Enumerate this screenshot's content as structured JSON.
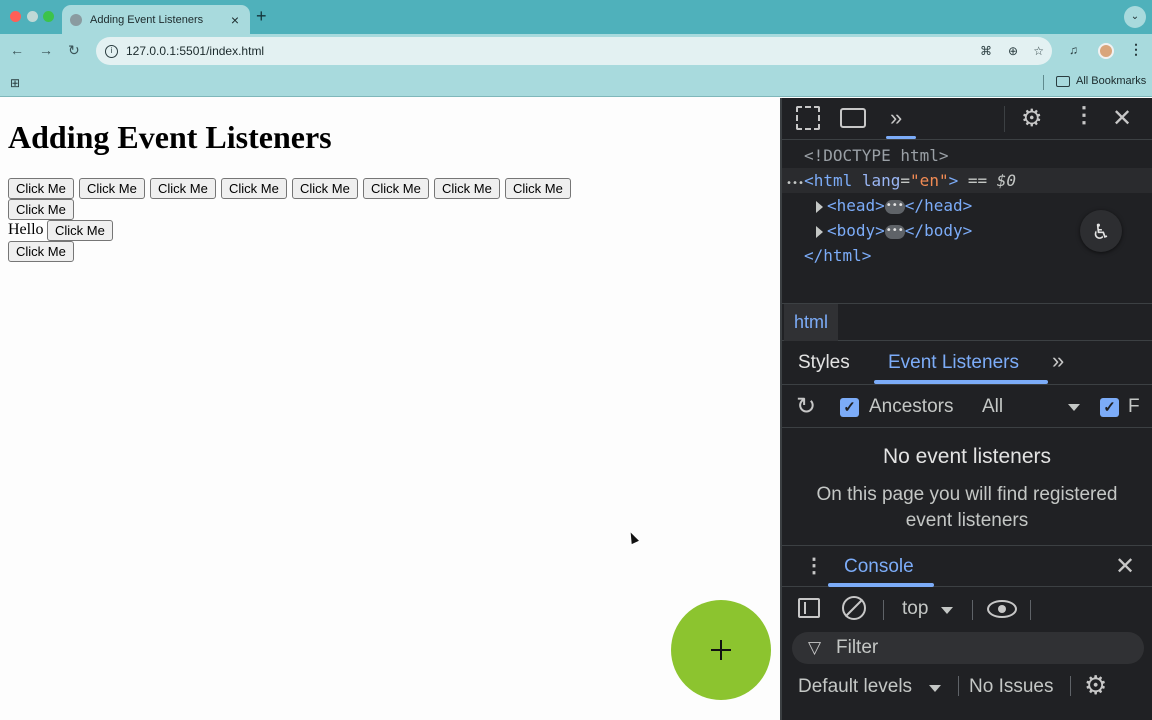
{
  "browser": {
    "tab_title": "Adding Event Listeners",
    "tab_close": "×",
    "new_tab": "+",
    "tab_search": "⌄",
    "url": "127.0.0.1:5501/index.html",
    "site_info": "i",
    "bookmarks_label": "All Bookmarks"
  },
  "page": {
    "heading": "Adding Event Listeners",
    "button_label": "Click Me",
    "hello_text": "Hello"
  },
  "devtools": {
    "elements": {
      "doctype": "<!DOCTYPE html>",
      "html_open": "<html",
      "lang_attr": "lang",
      "lang_val": "\"en\"",
      "html_close_bracket": ">",
      "selected_marker": "== $0",
      "head_open": "<head>",
      "head_close": "</head>",
      "body_open": "<body>",
      "body_close": "</body>",
      "html_close": "</html>",
      "ellipsis": "•••"
    },
    "breadcrumb": "html",
    "tabs": {
      "styles": "Styles",
      "event_listeners": "Event Listeners"
    },
    "listeners_bar": {
      "ancestors": "Ancestors",
      "filter_select": "All",
      "framework": "F"
    },
    "empty": {
      "title": "No event listeners",
      "body": "On this page you will find registered event listeners"
    },
    "drawer": {
      "console_tab": "Console"
    },
    "console": {
      "context": "top",
      "filter_placeholder": "Filter",
      "levels": "Default levels",
      "issues": "No Issues"
    }
  },
  "colors": {
    "fab": "#8cc42f",
    "accent": "#7cacf8",
    "tabbar": "#4fb1bb"
  }
}
